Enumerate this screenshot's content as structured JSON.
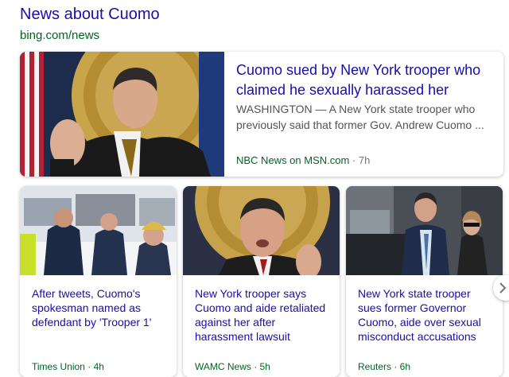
{
  "section": {
    "title": "News about Cuomo",
    "source": "bing.com/news"
  },
  "top_story": {
    "headline": "Cuomo sued by New York trooper who claimed he sexually harassed her",
    "snippet": "WASHINGTON — A New York state trooper who previously said that former Gov. Andrew Cuomo ...",
    "publisher": "NBC News on MSN.com",
    "separator": " · ",
    "age": "7h",
    "image": "cuomo-press-conference-photo"
  },
  "stories": [
    {
      "headline": "After tweets, Cuomo's spokesman named as defendant by 'Trooper 1'",
      "meta": "Times Union · 4h",
      "image": "troopers-in-snow-photo"
    },
    {
      "headline": "New York trooper says Cuomo and aide retaliated against her after harassment lawsuit",
      "meta": "WAMC News · 5h",
      "image": "cuomo-speaking-photo"
    },
    {
      "headline": "New York state trooper sues former Governor Cuomo, aide over sexual misconduct accusations",
      "meta": "Reuters · 6h",
      "image": "cuomo-walking-street-photo"
    }
  ],
  "controls": {
    "next_icon": "chevron-right-icon"
  },
  "colors": {
    "link": "#1a0dab",
    "source_green": "#006621",
    "snippet_gray": "#545454"
  }
}
